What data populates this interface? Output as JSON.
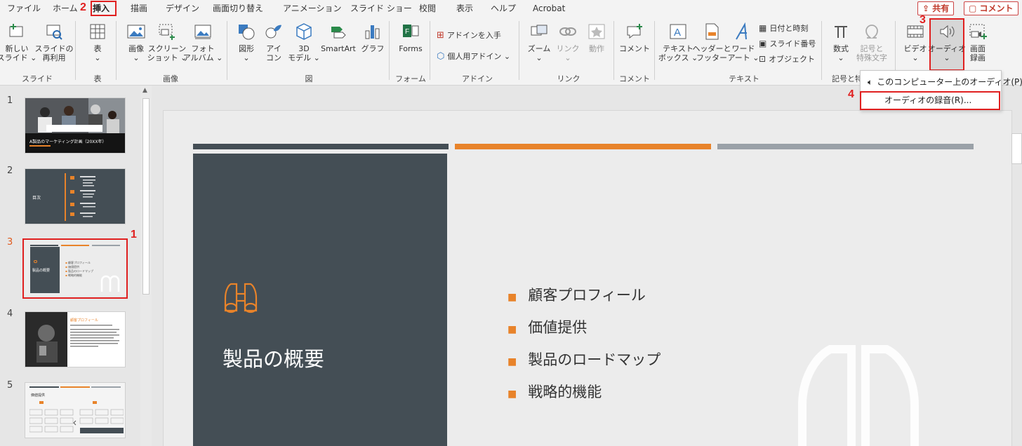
{
  "menubar": {
    "tabs": [
      "ファイル",
      "ホーム",
      "挿入",
      "描画",
      "デザイン",
      "画面切り替え",
      "アニメーション",
      "スライド ショー",
      "校閲",
      "表示",
      "ヘルプ",
      "Acrobat"
    ],
    "active_tab": "挿入",
    "share": "共有",
    "comment": "コメント"
  },
  "steps": [
    "1",
    "2",
    "3",
    "4"
  ],
  "ribbon": {
    "new_slide": "新しい\nスライド ⌄",
    "reuse_slide": "スライドの\n再利用",
    "table": "表\n⌄",
    "image": "画像\n⌄",
    "screenshot": "スクリーン\nショット ⌄",
    "photo_album": "フォト\nアルバム ⌄",
    "shape": "図形\n⌄",
    "icon": "アイ\nコン",
    "model3d": "3D\nモデル ⌄",
    "smartart": "SmartArt",
    "chart": "グラフ",
    "forms": "Forms",
    "get_addins": "アドインを入手",
    "my_addins": "個人用アドイン ⌄",
    "zoom": "ズーム\n⌄",
    "link": "リンク\n⌄",
    "action": "動作",
    "comment": "コメント",
    "textbox": "テキスト\nボックス ⌄",
    "header_footer": "ヘッダーと\nフッター",
    "wordart": "ワード\nアート ⌄",
    "date_time": "日付と時刻",
    "slide_number": "スライド番号",
    "object": "オブジェクト",
    "equation": "数式\n⌄",
    "symbol": "記号と\n特殊文字",
    "video": "ビデオ\n⌄",
    "audio": "オーディオ\n⌄",
    "screen_record": "画面\n録画",
    "groups": {
      "slides": "スライド",
      "tables": "表",
      "images": "画像",
      "illustrations": "図",
      "forms": "フォーム",
      "addins": "アドイン",
      "links": "リンク",
      "comments": "コメント",
      "text": "テキスト",
      "symbols": "記号と特"
    },
    "colors": {
      "accent": "#e05a1e",
      "highlight": "#e02020"
    }
  },
  "dropdown": {
    "items": [
      "このコンピューター上のオーディオ(P)...",
      "オーディオの録音(R)..."
    ]
  },
  "thumbnails": {
    "numbers": [
      "1",
      "2",
      "3",
      "4",
      "5"
    ],
    "slide1_title": "A製品のマーケティング計画（20XX年）",
    "slide2_title": "目次",
    "slide3_title": "製品の概要",
    "slide3_bullets": [
      "顧客プロフィール",
      "価値提供",
      "製品のロードマップ",
      "戦略的機能"
    ],
    "slide4_title": "顧客プロフィール",
    "slide5_title": "価値提供"
  },
  "slide": {
    "title": "製品の概要",
    "bullets": [
      "顧客プロフィール",
      "価値提供",
      "製品のロードマップ",
      "戦略的機能"
    ],
    "colors": {
      "dark": "#444e55",
      "orange": "#e8832a",
      "gray": "#9aa1a8"
    }
  }
}
